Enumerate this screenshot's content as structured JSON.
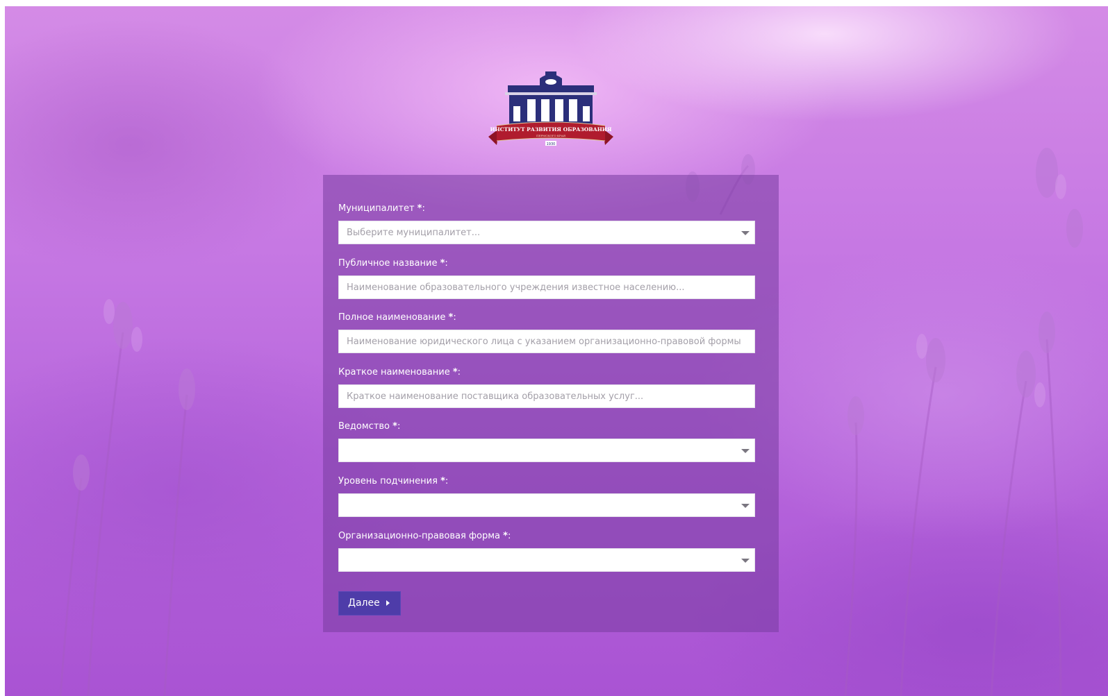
{
  "logo": {
    "line1": "ИНСТИТУТ РАЗВИТИЯ ОБРАЗОВАНИЯ",
    "line2": "ПЕРМСКОГО КРАЯ",
    "year": "1930"
  },
  "form": {
    "required_mark": "*",
    "fields": [
      {
        "label": "Муниципалитет",
        "type": "select",
        "placeholder": "Выберите муниципалитет..."
      },
      {
        "label": "Публичное название",
        "type": "text",
        "placeholder": "Наименование образовательного учреждения известное населению..."
      },
      {
        "label": "Полное наименование",
        "type": "text",
        "placeholder": "Наименование юридического лица с указанием организационно-правовой формы"
      },
      {
        "label": "Краткое наименование",
        "type": "text",
        "placeholder": "Краткое наименование поставщика образовательных услуг..."
      },
      {
        "label": "Ведомство",
        "type": "select",
        "placeholder": ""
      },
      {
        "label": "Уровень подчинения",
        "type": "select",
        "placeholder": ""
      },
      {
        "label": "Организационно-правовая форма",
        "type": "select",
        "placeholder": ""
      }
    ],
    "next_label": "Далее"
  },
  "colors": {
    "panel": "#78309f",
    "button": "#4e3ca9",
    "logo_navy": "#2b2f7a",
    "logo_red": "#b01c2e"
  }
}
